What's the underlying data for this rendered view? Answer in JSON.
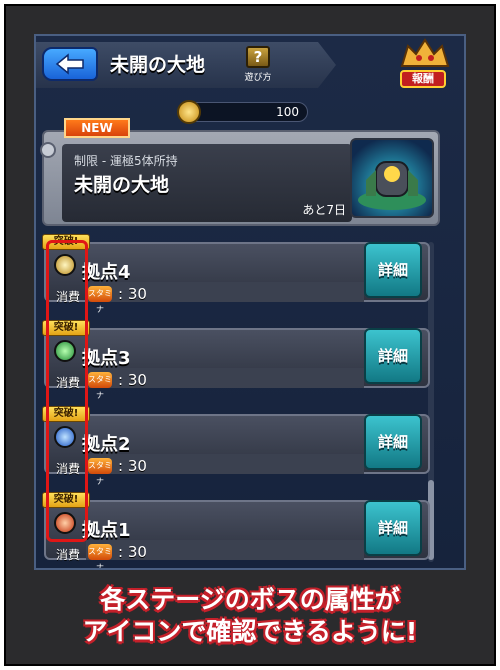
{
  "header": {
    "title": "未開の大地",
    "help_label": "遊び方",
    "help_symbol": "?",
    "reward_label": "報酬"
  },
  "stamina": {
    "value": "100"
  },
  "quest": {
    "badge": "NEW",
    "restriction": "制限 - 運極5体所持",
    "name": "未開の大地",
    "remaining": "あと7日"
  },
  "stages": [
    {
      "badge": "突破!",
      "name": "拠点4",
      "cost_label": "消費",
      "cost_icon_text": "スタミナ",
      "cost_value": ": 30",
      "detail_label": "詳細",
      "element": "light",
      "element_color": "#f2d45a"
    },
    {
      "badge": "突破!",
      "name": "拠点3",
      "cost_label": "消費",
      "cost_icon_text": "スタミナ",
      "cost_value": ": 30",
      "detail_label": "詳細",
      "element": "wood",
      "element_color": "#3cc85a"
    },
    {
      "badge": "突破!",
      "name": "拠点2",
      "cost_label": "消費",
      "cost_icon_text": "スタミナ",
      "cost_value": ": 30",
      "detail_label": "詳細",
      "element": "water",
      "element_color": "#3b8cf0"
    },
    {
      "badge": "突破!",
      "name": "拠点1",
      "cost_label": "消費",
      "cost_icon_text": "スタミナ",
      "cost_value": ": 30",
      "detail_label": "詳細",
      "element": "fire",
      "element_color": "#e8461e"
    }
  ],
  "caption": {
    "line1": "各ステージのボスの属性が",
    "line2": "アイコンで確認できるように!"
  }
}
